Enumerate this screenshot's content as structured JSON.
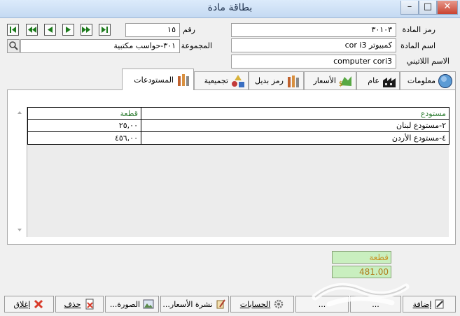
{
  "window": {
    "title": "بطاقة مادة",
    "minimize": "–",
    "maximize": "□",
    "close": "✕"
  },
  "nav": [
    "first",
    "prev-page",
    "prev",
    "next",
    "next-page",
    "last"
  ],
  "record": {
    "number_label": "رقم",
    "number_value": "١٥",
    "group_label": "المجموعة",
    "group_value": "٣٠١-حواسب مكتبية",
    "code_label": "رمز المادة",
    "code_value": "٣٠١٠٣",
    "name_label": "اسم المادة",
    "name_value": "كمبيوتر cor i3",
    "latin_label": "الاسم اللاتيني",
    "latin_value": "computer cori3"
  },
  "tabs": [
    {
      "id": "info",
      "label": "معلومات",
      "icon": "info-globe-icon"
    },
    {
      "id": "general",
      "label": "عام",
      "icon": "factory-icon"
    },
    {
      "id": "prices",
      "label": "الأسعار",
      "icon": "prices-icon"
    },
    {
      "id": "alt",
      "label": "رمز بديل",
      "icon": "alt-code-icon"
    },
    {
      "id": "assembly",
      "label": "تجميعية",
      "icon": "shapes-icon"
    },
    {
      "id": "stores",
      "label": "المستودعات",
      "icon": "warehouse-icon",
      "active": true
    }
  ],
  "grid": {
    "headers": {
      "store": "مستودع",
      "qty": "قطعة"
    },
    "rows": [
      {
        "store": "٢-مستودع لبنان",
        "qty": "٢٥,٠٠"
      },
      {
        "store": "٤-مستودع الأردن",
        "qty": "٤٥٦,٠٠"
      }
    ]
  },
  "totals": {
    "unit": "قطعة",
    "value": "481.00"
  },
  "toolbar": {
    "add": "إضافة",
    "hidden1": "...",
    "hidden2": "...",
    "accounts": "الحسابات",
    "price_list": "نشرة الأسعار...",
    "image": "الصورة...",
    "delete": "حذف",
    "close": "إغلاق"
  },
  "colors": {
    "accent_green": "#2e7d32",
    "total_bg": "#c9efbf",
    "close_red": "#d83a2a"
  }
}
